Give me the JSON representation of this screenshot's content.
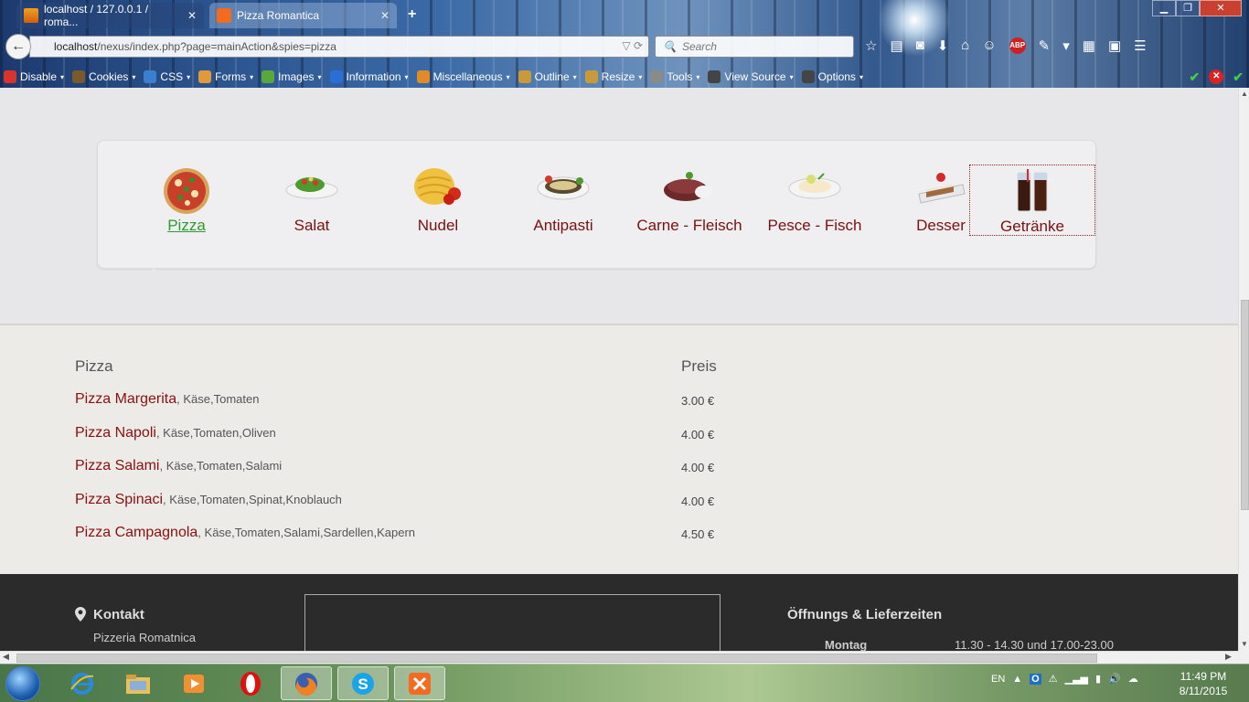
{
  "browser": {
    "tabs": [
      {
        "title": "localhost / 127.0.0.1 / roma...",
        "close": "✕"
      },
      {
        "title": "Pizza Romantica",
        "close": "✕"
      }
    ],
    "new_tab": "+",
    "url_host": "localhost",
    "url_path": "/nexus/index.php?page=mainAction&spies=pizza",
    "search_placeholder": "Search",
    "window_buttons": {
      "minimize": "▁",
      "maximize": "❐",
      "close": "✕"
    },
    "devbar": [
      {
        "label": "Disable",
        "icon": "disable-icon",
        "color": "#d9342b"
      },
      {
        "label": "Cookies",
        "icon": "cookies-icon",
        "color": "#7a5a2a"
      },
      {
        "label": "CSS",
        "icon": "css-icon",
        "color": "#3a7fd0"
      },
      {
        "label": "Forms",
        "icon": "forms-icon",
        "color": "#e09a3a"
      },
      {
        "label": "Images",
        "icon": "images-icon",
        "color": "#5aa83a"
      },
      {
        "label": "Information",
        "icon": "information-icon",
        "color": "#2a6fd8"
      },
      {
        "label": "Miscellaneous",
        "icon": "miscellaneous-icon",
        "color": "#e08a2a"
      },
      {
        "label": "Outline",
        "icon": "outline-icon",
        "color": "#c79a3a"
      },
      {
        "label": "Resize",
        "icon": "resize-icon",
        "color": "#c79a3a"
      },
      {
        "label": "Tools",
        "icon": "tools-icon",
        "color": "#8a8a8a"
      },
      {
        "label": "View Source",
        "icon": "view-source-icon",
        "color": "#444444"
      },
      {
        "label": "Options",
        "icon": "options-icon",
        "color": "#444444"
      }
    ]
  },
  "categories": [
    {
      "label": "Pizza",
      "icon": "pizza-icon",
      "state": "active"
    },
    {
      "label": "Salat",
      "icon": "salad-icon"
    },
    {
      "label": "Nudel",
      "icon": "noodles-icon"
    },
    {
      "label": "Antipasti",
      "icon": "antipasti-icon"
    },
    {
      "label": "Carne - Fleisch",
      "icon": "meat-icon"
    },
    {
      "label": "Pesce - Fisch",
      "icon": "fish-icon"
    },
    {
      "label": "Desser",
      "icon": "dessert-icon"
    },
    {
      "label": "Getränke",
      "icon": "drinks-icon",
      "state": "focused"
    }
  ],
  "menu": {
    "heading": "Pizza",
    "price_heading": "Preis",
    "items": [
      {
        "name": "Pizza Margerita",
        "ingredients": ", Käse,Tomaten",
        "price": "3.00 €"
      },
      {
        "name": "Pizza Napoli",
        "ingredients": ", Käse,Tomaten,Oliven",
        "price": "4.00 €"
      },
      {
        "name": "Pizza Salami",
        "ingredients": ", Käse,Tomaten,Salami",
        "price": "4.00 €"
      },
      {
        "name": "Pizza Spinaci",
        "ingredients": ", Käse,Tomaten,Spinat,Knoblauch",
        "price": "4.00 €"
      },
      {
        "name": "Pizza Campagnola",
        "ingredients": ", Käse,Tomaten,Salami,Sardellen,Kapern",
        "price": "4.50 €"
      }
    ]
  },
  "footer": {
    "contact_title": "Kontakt",
    "contact_name": "Pizzeria Romatnica",
    "hours_title": "Öffnungs & Lieferzeiten",
    "hours_day": "Montag",
    "hours_time": "11.30 - 14.30 und 17.00-23.00"
  },
  "taskbar": {
    "language": "EN",
    "time": "11:49 PM",
    "date": "8/11/2015"
  }
}
